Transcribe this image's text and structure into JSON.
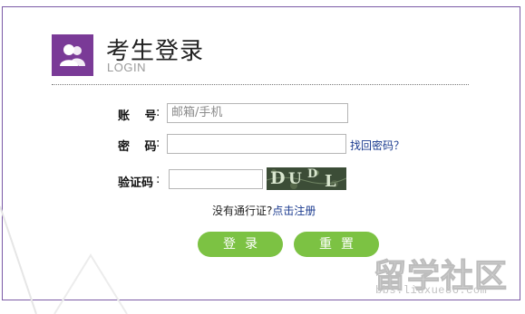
{
  "header": {
    "title": "考生登录",
    "subtitle": "LOGIN"
  },
  "form": {
    "account_label": "账 号",
    "account_colon": ":",
    "account_placeholder": "邮箱/手机",
    "password_label": "密 码",
    "password_colon": ":",
    "password_value": "",
    "forgot_link": "找回密码？",
    "captcha_label": "验证码",
    "captcha_colon": ":",
    "captcha_value": "",
    "captcha_text": "DUDL"
  },
  "register": {
    "question": "没有通行证?",
    "link": "点击注册"
  },
  "buttons": {
    "login": "登录",
    "reset": "重置"
  },
  "watermark": {
    "main": "留学社区",
    "url": "bbs.liuxue86.com"
  },
  "colors": {
    "brand_purple": "#7a3a97",
    "button_green": "#7cc243",
    "link_blue": "#1a3a8f",
    "border_purple": "#7b5aa6"
  }
}
